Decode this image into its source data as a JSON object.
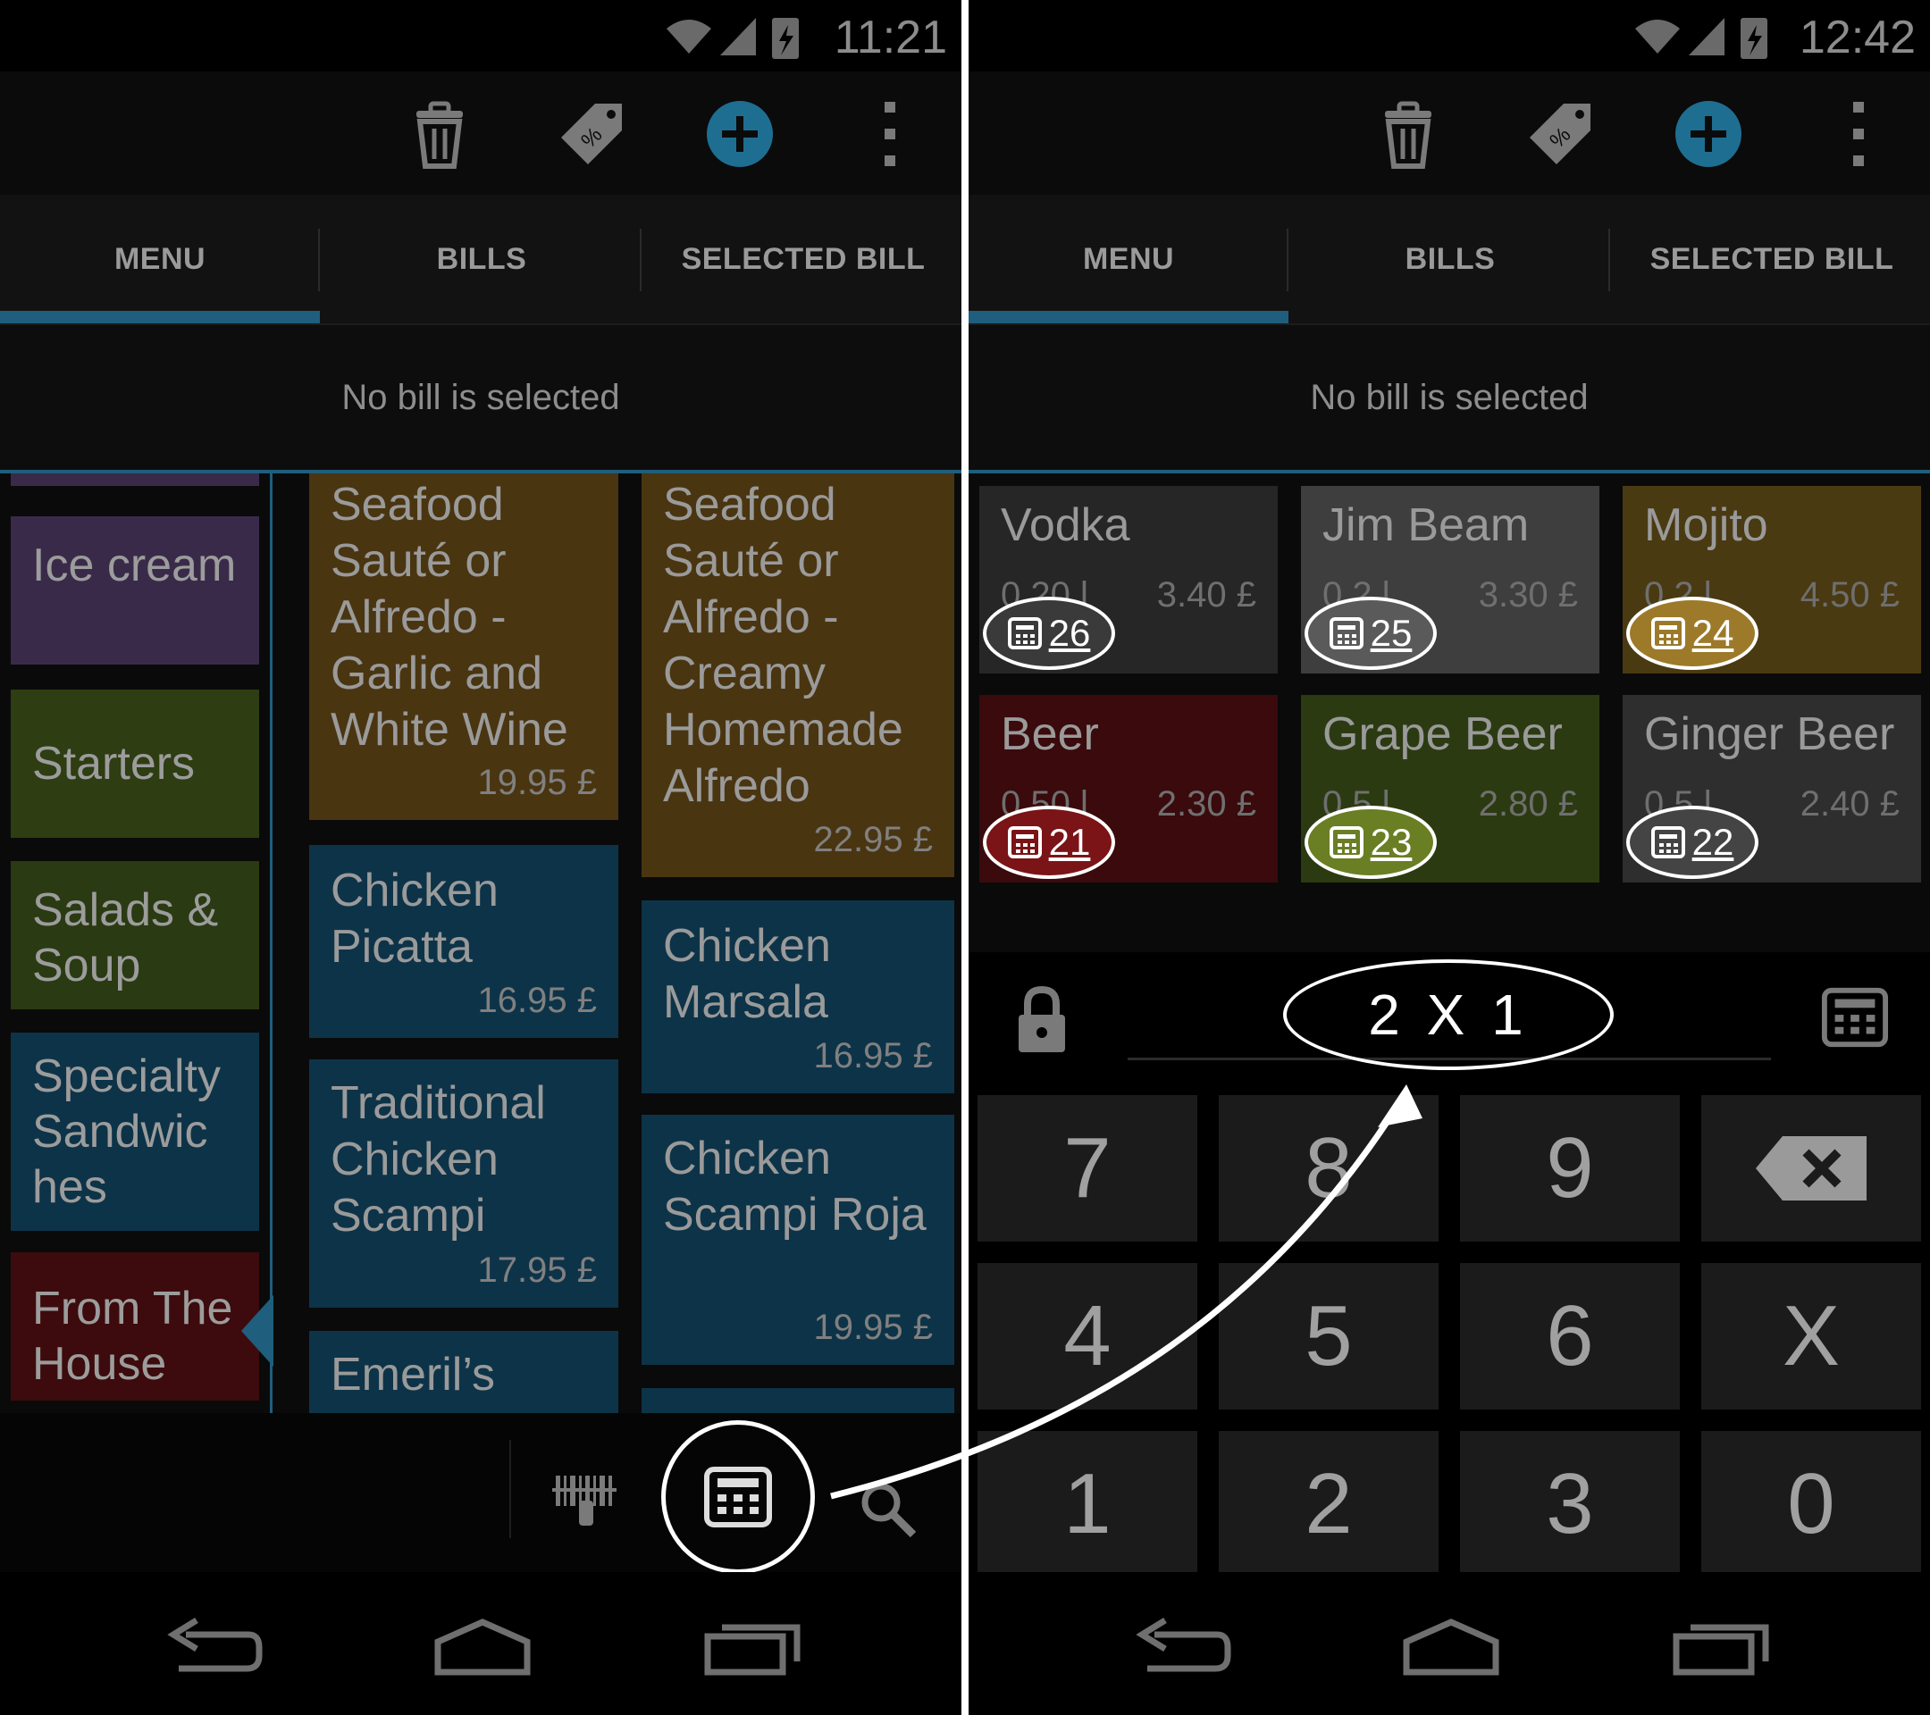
{
  "left": {
    "status": {
      "time": "11:21"
    },
    "tabs": [
      "MENU",
      "BILLS",
      "SELECTED BILL"
    ],
    "no_bill": "No bill is selected",
    "categories": [
      {
        "label": "Ice cream",
        "color": "#3a2a4a"
      },
      {
        "label": "Starters",
        "color": "#2e3d12"
      },
      {
        "label": "Salads & Soup",
        "color": "#2a3a12"
      },
      {
        "label": "Specialty Sandwic hes",
        "color": "#0d3348"
      },
      {
        "label": "From The House",
        "color": "#3d0b0d"
      }
    ],
    "items_col1": [
      {
        "name": "Seafood Sauté or Alfredo - Garlic and White Wine",
        "price": "19.95 £",
        "color": "#4a3511"
      },
      {
        "name": "Chicken Picatta",
        "price": "16.95 £",
        "color": "#0d3348"
      },
      {
        "name": "Traditional Chicken Scampi",
        "price": "17.95 £",
        "color": "#0d3348"
      },
      {
        "name": "Emeril’s",
        "price": "",
        "color": "#0d3348"
      }
    ],
    "items_col2": [
      {
        "name": "Seafood Sauté or Alfredo - Creamy Homemade Alfredo",
        "price": "22.95 £",
        "color": "#4a3511"
      },
      {
        "name": "Chicken Marsala",
        "price": "16.95 £",
        "color": "#0d3348"
      },
      {
        "name": "Chicken Scampi Roja",
        "price": "19.95 £",
        "color": "#0d3348"
      }
    ]
  },
  "right": {
    "status": {
      "time": "12:42"
    },
    "tabs": [
      "MENU",
      "BILLS",
      "SELECTED BILL"
    ],
    "no_bill": "No bill is selected",
    "drinks": [
      {
        "name": "Vodka",
        "volume": "0.20 l",
        "price": "3.40 £",
        "count": "26",
        "color": "#262626",
        "badge": "#3a3a3a"
      },
      {
        "name": "Jim Beam",
        "volume": "0.2 l",
        "price": "3.30 £",
        "count": "25",
        "color": "#3e3e3e",
        "badge": "#5a5a5a"
      },
      {
        "name": "Mojito",
        "volume": "0.2 l",
        "price": "4.50 £",
        "count": "24",
        "color": "#4a3a12",
        "badge": "#9c7a2a"
      },
      {
        "name": "Beer",
        "volume": "0.50 l",
        "price": "2.30 £",
        "count": "21",
        "color": "#3a0a0c",
        "badge": "#7a1416"
      },
      {
        "name": "Grape Beer",
        "volume": "0.5 l",
        "price": "2.80 £",
        "count": "23",
        "color": "#2c3a12",
        "badge": "#6a7e24"
      },
      {
        "name": "Ginger Beer",
        "volume": "0.5 l",
        "price": "2.40 £",
        "count": "22",
        "color": "#2e2e2e",
        "badge": "#444444"
      }
    ],
    "quantity_display": "2 X 1",
    "keypad": [
      [
        "7",
        "8",
        "9",
        "⌫"
      ],
      [
        "4",
        "5",
        "6",
        "X"
      ],
      [
        "1",
        "2",
        "3",
        "0"
      ]
    ]
  },
  "colors": {
    "accent": "#1f5e7d",
    "add_button": "#1e6e92"
  }
}
